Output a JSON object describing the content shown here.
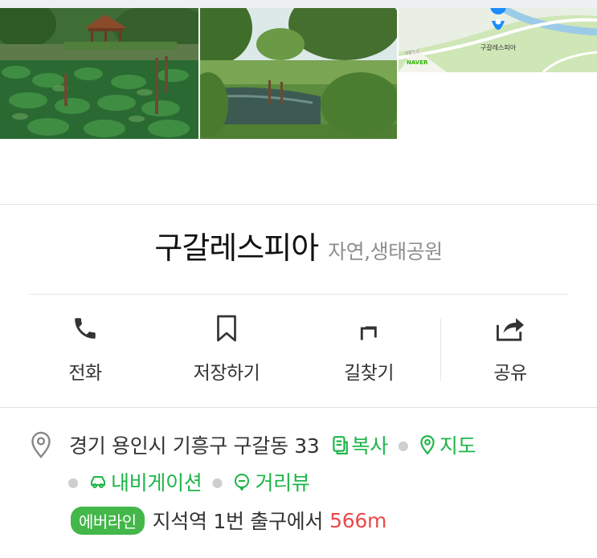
{
  "place": {
    "name": "구갈레스피아",
    "category": "자연,생태공원"
  },
  "map_thumb": {
    "pin_label": "구갈레스피아",
    "provider": "NAVER",
    "road_label": "신갈천로"
  },
  "actions": [
    {
      "label": "전화",
      "icon": "phone-icon"
    },
    {
      "label": "저장하기",
      "icon": "bookmark-icon"
    },
    {
      "label": "길찾기",
      "icon": "directions-arrow-icon"
    },
    {
      "label": "공유",
      "icon": "share-icon"
    }
  ],
  "address": {
    "text": "경기 용인시 기흥구 구갈동 33",
    "copy_label": "복사",
    "map_label": "지도",
    "navigation_label": "내비게이션",
    "streetview_label": "거리뷰"
  },
  "transit": {
    "line_badge": "에버라인",
    "station_text": "지석역 1번 출구에서",
    "distance": "566m"
  },
  "colors": {
    "accent_green": "#1db549",
    "badge_green": "#43b749",
    "distance_red": "#e84a4a",
    "category_gray": "#8e8e8e",
    "map_pin_blue": "#1a8cff"
  }
}
